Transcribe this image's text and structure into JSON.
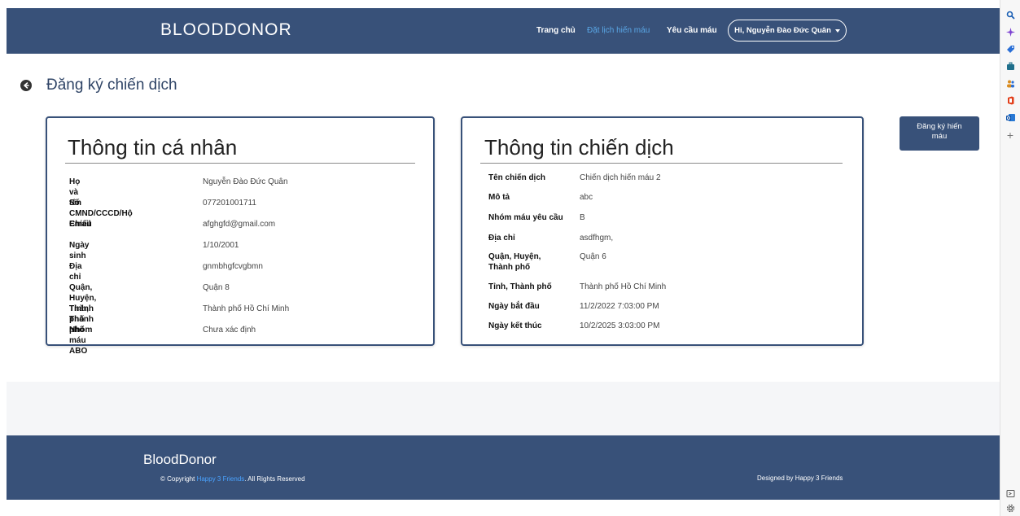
{
  "navbar": {
    "brand": "BLOODDONOR",
    "links": [
      "Trang chủ",
      "Đặt lịch hiến máu",
      "Yêu cầu máu"
    ],
    "user": "Hi, Nguyễn Đào Đức Quân"
  },
  "page": {
    "title": "Đăng ký chiến dịch",
    "register_button": "Đăng ký hiến máu"
  },
  "personal": {
    "title": "Thông tin cá nhân",
    "rows": [
      {
        "label": "Họ và tên",
        "value": "Nguyễn Đào Đức Quân"
      },
      {
        "label": "Số CMND/CCCD/Hộ Chiếu",
        "value": "077201001711"
      },
      {
        "label": "Email",
        "value": "afghgfd@gmail.com"
      },
      {
        "label": "Ngày sinh",
        "value": "1/10/2001"
      },
      {
        "label": "Địa chỉ",
        "value": "gnmbhgfcvgbmn"
      },
      {
        "label": "Quận, Huyện, Thành phố",
        "value": "Quận 8"
      },
      {
        "label": "Tỉnh, Thành phố",
        "value": "Thành phố Hồ Chí Minh"
      },
      {
        "label": "Nhóm máu ABO",
        "value": "Chưa xác định"
      }
    ]
  },
  "campaign": {
    "title": "Thông tin chiến dịch",
    "rows": [
      {
        "label": "Tên chiến dịch",
        "value": "Chiến dịch hiến máu 2"
      },
      {
        "label": "Mô tả",
        "value": "abc"
      },
      {
        "label": "Nhóm máu yêu cầu",
        "value": "B"
      },
      {
        "label": "Địa chỉ",
        "value": "asdfhgm,"
      },
      {
        "label": "Quận, Huyện, Thành phố",
        "value": "Quận 6"
      },
      {
        "label": "Tỉnh, Thành phố",
        "value": "Thành phố Hồ Chí Minh"
      },
      {
        "label": "Ngày bắt đầu",
        "value": "11/2/2022 7:03:00 PM"
      },
      {
        "label": "Ngày kết thúc",
        "value": "10/2/2025 3:03:00 PM"
      }
    ]
  },
  "footer": {
    "brand": "BloodDonor",
    "copy_prefix": "© Copyright ",
    "copy_link": "Happy 3 Friends",
    "copy_suffix": ". All Rights Reserved",
    "right": "Designed by Happy 3 Friends"
  },
  "browser_sidebar_icons": [
    "search-icon",
    "sparkle-icon",
    "tag-icon",
    "briefcase-icon",
    "people-icon",
    "office-icon",
    "outlook-icon",
    "plus-icon",
    "screen-icon",
    "gear-icon"
  ]
}
